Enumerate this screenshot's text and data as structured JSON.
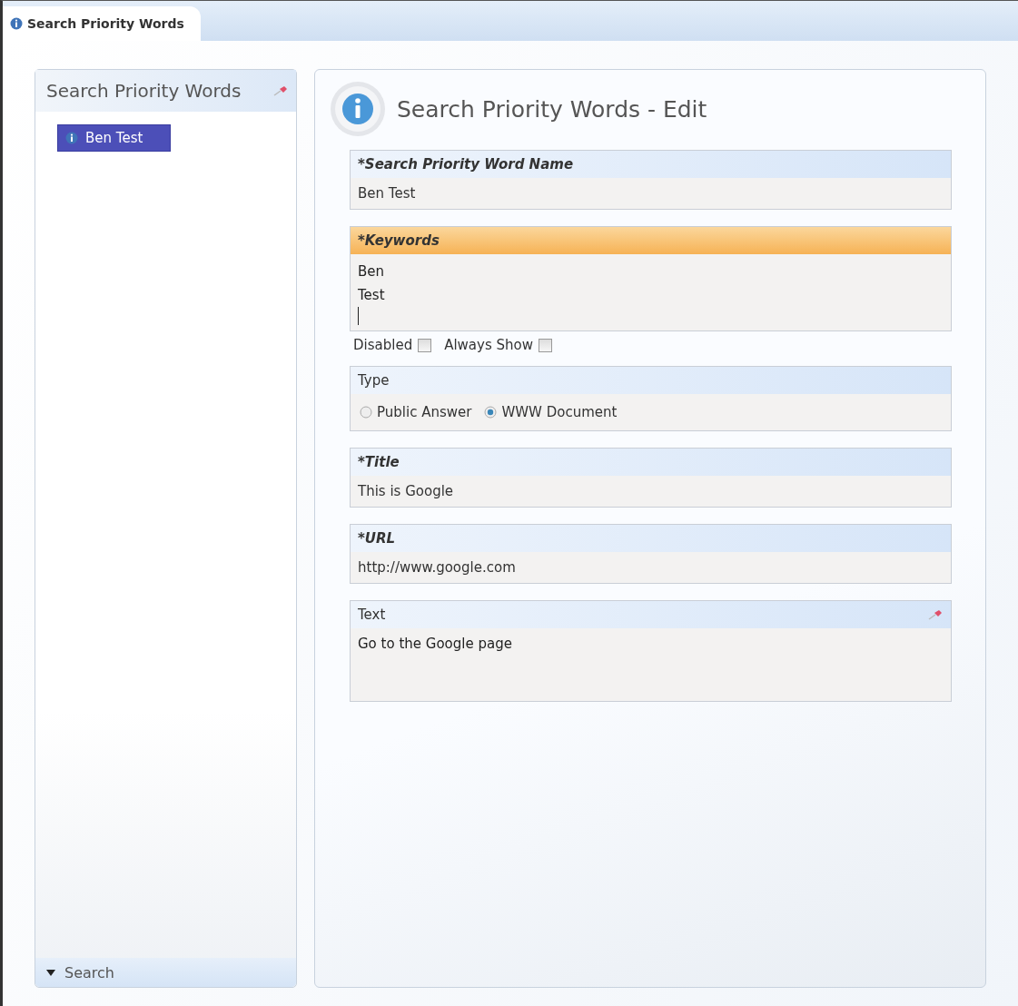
{
  "tab": {
    "title": "Search Priority Words",
    "selected": true
  },
  "sidebar": {
    "title": "Search Priority Words",
    "items": [
      {
        "label": "Ben Test",
        "selected": true
      }
    ],
    "footer": {
      "label": "Search"
    }
  },
  "form": {
    "title": "Search Priority Words - Edit",
    "sections": [
      {
        "kind": "text",
        "label": "*Search Priority Word Name",
        "required": true,
        "focused": false,
        "value": "Ben Test"
      },
      {
        "kind": "multiline",
        "label": "*Keywords",
        "required": true,
        "focused": true,
        "lines": [
          "Ben",
          "Test"
        ]
      },
      {
        "kind": "checks",
        "items": [
          {
            "label": "Disabled",
            "checked": false
          },
          {
            "label": "Always Show",
            "checked": false
          }
        ]
      },
      {
        "kind": "radio",
        "label": "Type",
        "required": false,
        "focused": false,
        "options": [
          {
            "label": "Public Answer",
            "selected": false
          },
          {
            "label": "WWW Document",
            "selected": true
          }
        ]
      },
      {
        "kind": "text",
        "label": "*Title",
        "required": true,
        "focused": false,
        "value": "This is Google"
      },
      {
        "kind": "text",
        "label": "*URL",
        "required": true,
        "focused": false,
        "value": "http://www.google.com"
      },
      {
        "kind": "memo",
        "label": "Text",
        "required": false,
        "focused": false,
        "pinned": true,
        "value": "Go to the Google page"
      }
    ]
  }
}
